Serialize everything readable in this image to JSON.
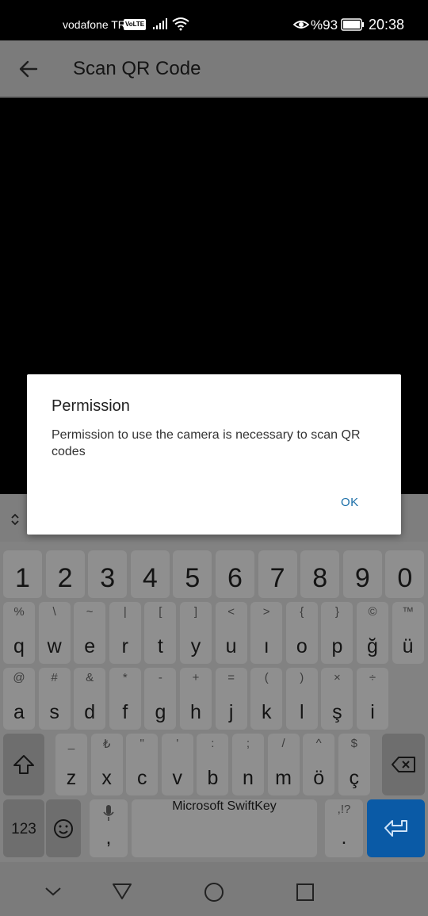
{
  "status_bar": {
    "carrier": "vodafone TR",
    "volte": "VoLTE",
    "battery": "%93",
    "time": "20:38"
  },
  "app_bar": {
    "title": "Scan QR Code"
  },
  "dialog": {
    "title": "Permission",
    "message": "Permission to use the camera is necessary to scan QR codes",
    "ok_label": "OK"
  },
  "keyboard": {
    "numbers": [
      "1",
      "2",
      "3",
      "4",
      "5",
      "6",
      "7",
      "8",
      "9",
      "0"
    ],
    "row1": [
      {
        "hint": "%",
        "key": "q"
      },
      {
        "hint": "\\",
        "key": "w"
      },
      {
        "hint": "~",
        "key": "e"
      },
      {
        "hint": "|",
        "key": "r"
      },
      {
        "hint": "[",
        "key": "t"
      },
      {
        "hint": "]",
        "key": "y"
      },
      {
        "hint": "<",
        "key": "u"
      },
      {
        "hint": ">",
        "key": "ı"
      },
      {
        "hint": "{",
        "key": "o"
      },
      {
        "hint": "}",
        "key": "p"
      },
      {
        "hint": "©",
        "key": "ğ"
      },
      {
        "hint": "™",
        "key": "ü"
      }
    ],
    "row2": [
      {
        "hint": "@",
        "key": "a"
      },
      {
        "hint": "#",
        "key": "s"
      },
      {
        "hint": "&",
        "key": "d"
      },
      {
        "hint": "*",
        "key": "f"
      },
      {
        "hint": "-",
        "key": "g"
      },
      {
        "hint": "+",
        "key": "h"
      },
      {
        "hint": "=",
        "key": "j"
      },
      {
        "hint": "(",
        "key": "k"
      },
      {
        "hint": ")",
        "key": "l"
      },
      {
        "hint": "×",
        "key": "ş"
      },
      {
        "hint": "÷",
        "key": "i"
      }
    ],
    "row3": [
      {
        "hint": "_",
        "key": "z"
      },
      {
        "hint": "₺",
        "key": "x"
      },
      {
        "hint": "\"",
        "key": "c"
      },
      {
        "hint": "'",
        "key": "v"
      },
      {
        "hint": ":",
        "key": "b"
      },
      {
        "hint": ";",
        "key": "n"
      },
      {
        "hint": "/",
        "key": "m"
      },
      {
        "hint": "^",
        "key": "ö"
      },
      {
        "hint": "$",
        "key": "ç"
      }
    ],
    "numeric_label": "123",
    "comma": ",",
    "space_brand": "Microsoft SwiftKey",
    "punct_hint": ",!?",
    "period": "."
  }
}
